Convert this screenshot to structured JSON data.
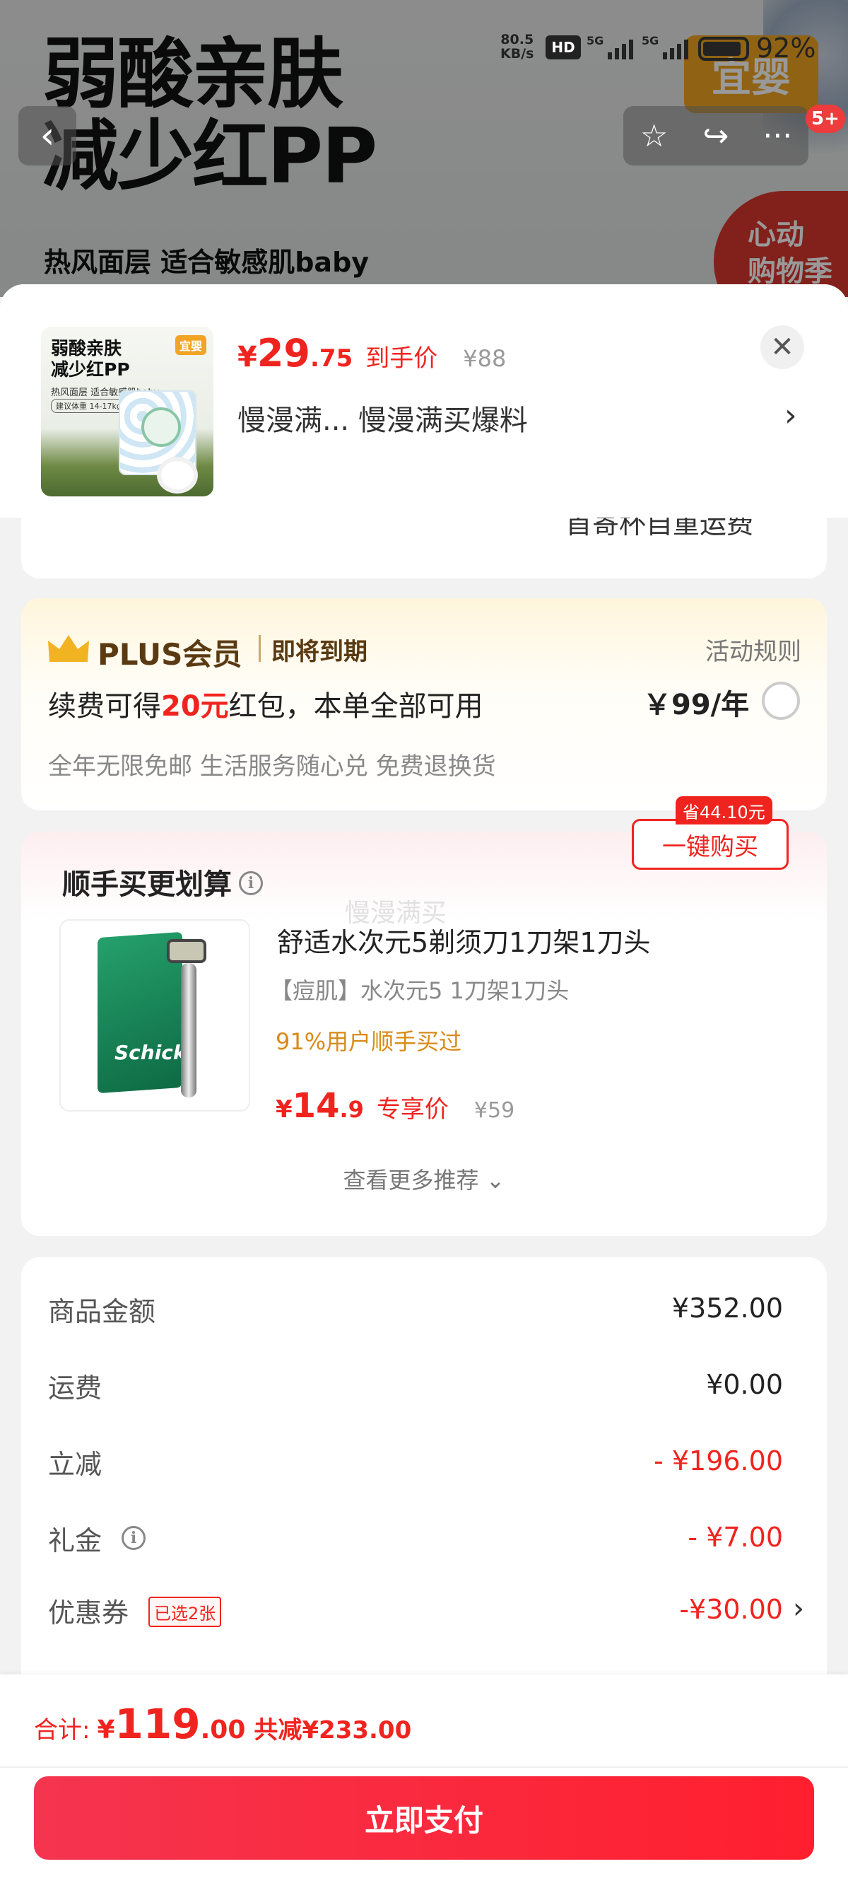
{
  "background": {
    "title_line1": "弱酸亲肤",
    "title_line2": "减少红PP",
    "subtitle": "热风面层 适合敏感肌baby",
    "brand_badge": "宜婴",
    "event_badge_line1": "心动",
    "event_badge_line2": "购物季"
  },
  "status_bar": {
    "network_speed_value": "80.5",
    "network_speed_unit": "KB/s",
    "hd_label": "HD",
    "sim1_label": "5G",
    "sim2_label": "5G",
    "battery_percent": "92%"
  },
  "top_actions": {
    "back_icon": "chevron-left-icon",
    "favorite_icon": "star-icon",
    "share_icon": "share-icon",
    "more_icon": "more-dots-icon",
    "notification_badge": "5+"
  },
  "product": {
    "thumb_title_line1": "弱酸亲肤",
    "thumb_title_line2": "减少红PP",
    "thumb_desc": "热风面层 适合敏感肌baby",
    "thumb_spec": "建议体重 14-17kg",
    "thumb_brand": "宜婴",
    "currency": "¥",
    "price_int": "29",
    "price_dec": ".75",
    "price_label": "到手价",
    "original_price": "¥88",
    "promo_text": "慢漫满...  慢漫满买爆料",
    "close_icon": "close-icon",
    "chevron": "›"
  },
  "cut_text": "首寄杯自重运费",
  "plus": {
    "brand": "PLUS会员",
    "expire": "即将到期",
    "rules": "活动规则",
    "main_prefix": "续费可得",
    "main_highlight": "20元",
    "main_suffix": "红包，本单全部可用",
    "price": "￥99/年",
    "desc": "全年无限免邮 生活服务随心兑 免费退换货",
    "accent_color": "#5a3a12",
    "crown_color": "#f2b323"
  },
  "recommend": {
    "title": "顺手买更划算",
    "info_icon": "ⓘ",
    "watermark": "慢漫满买",
    "brand_on_pack": "Schick",
    "name": "舒适水次元5剃须刀1刀架1刀头",
    "spec": "【痘肌】水次元5 1刀架1刀头",
    "social_proof": "91%用户顺手买过",
    "currency": "¥",
    "price_int": "14",
    "price_dec": ".9",
    "price_label": "专享价",
    "original_price": "¥59",
    "save_tag": "省44.10元",
    "buy_label": "一键购买",
    "more_label": "查看更多推荐 ⌄"
  },
  "totals": {
    "rows": [
      {
        "label": "商品金额",
        "value": "¥352.00"
      },
      {
        "label": "运费",
        "value": "¥0.00"
      },
      {
        "label": "立减",
        "value": "- ¥196.00"
      },
      {
        "label": "礼金",
        "value": "- ¥7.00"
      },
      {
        "label": "优惠券",
        "value": "-¥30.00",
        "chip": "已选2张"
      }
    ]
  },
  "bottom": {
    "total_label": "合计:",
    "currency": "¥",
    "total_int": "119",
    "total_dec": ".00",
    "reduce_text": "共减¥233.00",
    "pay_label": "立即支付",
    "brand_color": "#f0241f"
  }
}
